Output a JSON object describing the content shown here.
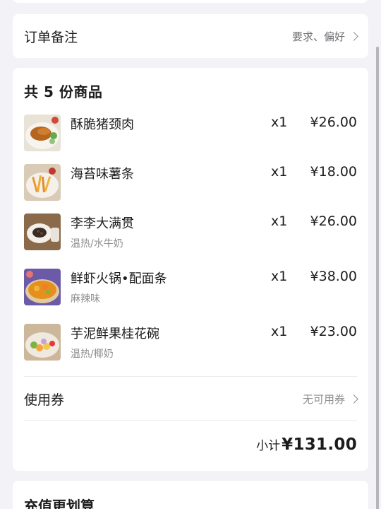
{
  "remark": {
    "label": "订单备注",
    "hint": "要求、偏好"
  },
  "items_section": {
    "title": "共 5 份商品",
    "items": [
      {
        "name": "酥脆猪颈肉",
        "spec": "",
        "qty": "x1",
        "price": "¥26.00"
      },
      {
        "name": "海苔味薯条",
        "spec": "",
        "qty": "x1",
        "price": "¥18.00"
      },
      {
        "name": "李李大满贯",
        "spec": "温热/水牛奶",
        "qty": "x1",
        "price": "¥26.00"
      },
      {
        "name": "鲜虾火锅•配面条",
        "spec": "麻辣味",
        "qty": "x1",
        "price": "¥38.00"
      },
      {
        "name": "芋泥鲜果桂花碗",
        "spec": "温热/椰奶",
        "qty": "x1",
        "price": "¥23.00"
      }
    ]
  },
  "coupon": {
    "label": "使用券",
    "hint": "无可用券"
  },
  "subtotal": {
    "label": "小计",
    "value": "¥131.00"
  },
  "recharge": {
    "title": "充值更划算"
  }
}
